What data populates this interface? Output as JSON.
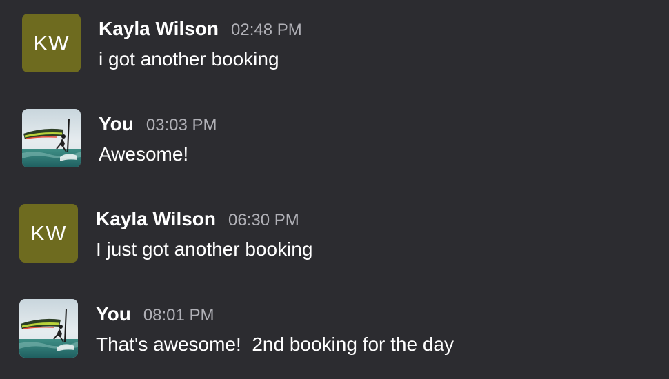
{
  "messages": [
    {
      "sender": "Kayla Wilson",
      "time": "02:48 PM",
      "text": "i got another booking",
      "avatar": {
        "type": "initials",
        "initials": "KW",
        "color": "#6e6b1f"
      }
    },
    {
      "sender": "You",
      "time": "03:03 PM",
      "text": "Awesome!",
      "avatar": {
        "type": "photo",
        "icon": "windsurfer-photo"
      }
    },
    {
      "sender": "Kayla Wilson",
      "time": "06:30 PM",
      "text": "I just got another booking",
      "avatar": {
        "type": "initials",
        "initials": "KW",
        "color": "#6e6b1f"
      }
    },
    {
      "sender": "You",
      "time": "08:01 PM",
      "text": "That's awesome!  2nd booking for the day",
      "avatar": {
        "type": "photo",
        "icon": "windsurfer-photo"
      }
    }
  ],
  "colors": {
    "background": "#2c2c30",
    "initials_avatar": "#6e6b1f",
    "timestamp": "#b0b0b6",
    "text": "#ffffff"
  }
}
